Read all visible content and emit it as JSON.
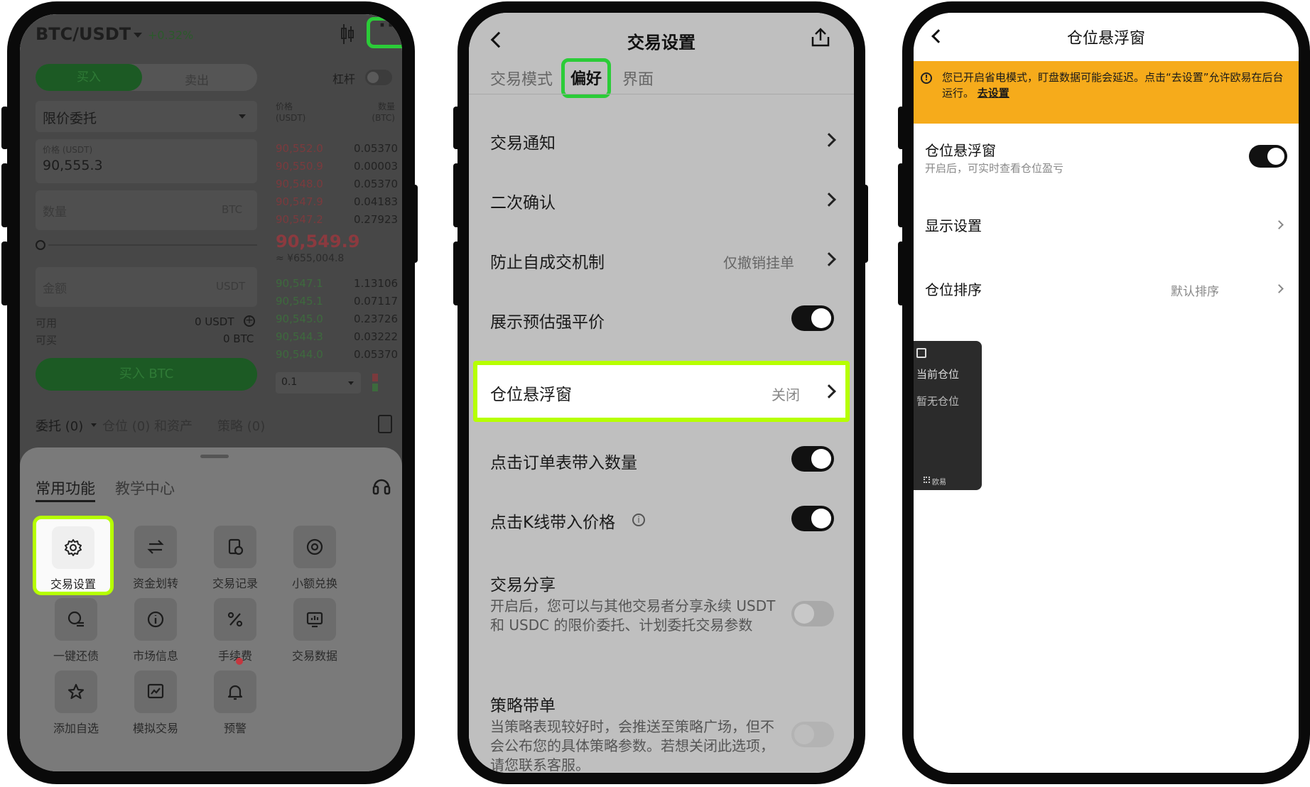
{
  "phone1": {
    "pair": "BTC/USDT",
    "change": "+0.32%",
    "buy_tab": "买入",
    "sell_tab": "卖出",
    "leverage": "杠杆",
    "order_type": "限价委托",
    "price_label": "价格 (USDT)",
    "price_value": "90,555.3",
    "qty_placeholder": "数量",
    "qty_unit": "BTC",
    "amount_placeholder": "金额",
    "amount_unit": "USDT",
    "available_label": "可用",
    "available_value": "0 USDT",
    "can_buy_label": "可买",
    "can_buy_value": "0 BTC",
    "buy_button": "买入 BTC",
    "ob_price_header": "价格\n(USDT)",
    "ob_qty_header": "数量\n(BTC)",
    "asks": [
      {
        "p": "90,552.0",
        "q": "0.05370"
      },
      {
        "p": "90,550.9",
        "q": "0.00003"
      },
      {
        "p": "90,548.0",
        "q": "0.05370"
      },
      {
        "p": "90,547.9",
        "q": "0.04183"
      },
      {
        "p": "90,547.2",
        "q": "0.27923"
      }
    ],
    "last_price": "90,549.9",
    "last_price_fiat": "≈ ¥655,004.8",
    "bids": [
      {
        "p": "90,547.1",
        "q": "1.13106"
      },
      {
        "p": "90,545.1",
        "q": "0.07117"
      },
      {
        "p": "90,545.0",
        "q": "0.23726"
      },
      {
        "p": "90,544.3",
        "q": "0.03222"
      },
      {
        "p": "90,544.0",
        "q": "0.05370"
      }
    ],
    "depth_select": "0.1",
    "bottom_tabs": [
      "委托 (0)",
      "仓位 (0) 和资产",
      "策略 (0)"
    ],
    "sheet_tabs": [
      "常用功能",
      "教学中心"
    ],
    "tiles": [
      {
        "label": "交易设置",
        "icon": "gear-icon"
      },
      {
        "label": "资金划转",
        "icon": "transfer-icon"
      },
      {
        "label": "交易记录",
        "icon": "record-icon"
      },
      {
        "label": "小额兑换",
        "icon": "exchange-icon"
      },
      {
        "label": "一键还债",
        "icon": "repay-icon"
      },
      {
        "label": "市场信息",
        "icon": "info-icon"
      },
      {
        "label": "手续费",
        "icon": "percent-icon"
      },
      {
        "label": "交易数据",
        "icon": "data-icon"
      },
      {
        "label": "添加自选",
        "icon": "star-icon"
      },
      {
        "label": "模拟交易",
        "icon": "demo-icon"
      },
      {
        "label": "预警",
        "icon": "bell-icon"
      }
    ]
  },
  "phone2": {
    "title": "交易设置",
    "tabs": [
      "交易模式",
      "偏好",
      "界面"
    ],
    "rows": {
      "notify": "交易通知",
      "confirm": "二次确认",
      "self_trade": "防止自成交机制",
      "self_trade_value": "仅撤销挂单",
      "liq_price": "展示预估强平价",
      "float_window": "仓位悬浮窗",
      "float_window_value": "关闭",
      "click_order_qty": "点击订单表带入数量",
      "click_kline_price": "点击K线带入价格",
      "share": "交易分享",
      "share_desc": "开启后，您可以与其他交易者分享永续 USDT 和 USDC 的限价委托、计划委托交易参数",
      "strategy": "策略带单",
      "strategy_desc": "当策略表现较好时，会推送至策略广场，但不会公布您的具体策略参数。若想关闭此选项，请您联系客服。"
    }
  },
  "phone3": {
    "title": "仓位悬浮窗",
    "banner_text": "您已开启省电模式，盯盘数据可能会延迟。点击“去设置”允许欧易在后台运行。",
    "banner_link": "去设置",
    "float_title": "仓位悬浮窗",
    "float_desc": "开启后，可实时查看仓位盈亏",
    "display_settings": "显示设置",
    "sort_label": "仓位排序",
    "sort_value": "默认排序",
    "widget_current": "当前仓位",
    "widget_empty": "暂无仓位",
    "widget_brand": "欧易"
  },
  "colors": {
    "highlight_green": "#2bcc38",
    "highlight_lime": "#b6ff00",
    "banner_orange": "#f6ab1b"
  }
}
